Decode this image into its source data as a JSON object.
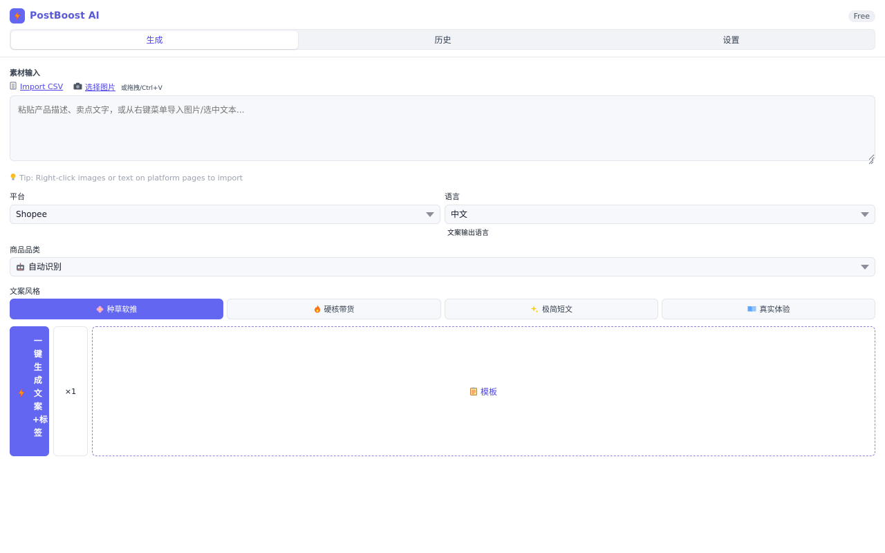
{
  "app": {
    "name": "PostBoost AI",
    "plan": "Free",
    "brand_color": "#6366f1"
  },
  "tabs": [
    {
      "label": "生成",
      "active": true
    },
    {
      "label": "历史",
      "active": false
    },
    {
      "label": "设置",
      "active": false
    }
  ],
  "material": {
    "label": "素材输入",
    "import_csv": "Import CSV",
    "choose_image": "选择图片",
    "drag_hint": "或拖拽/Ctrl+V",
    "placeholder": "粘贴产品描述、卖点文字，或从右键菜单导入图片/选中文本...",
    "tip": "Tip: Right-click images or text on platform pages to import"
  },
  "platform": {
    "label": "平台",
    "value": "Shopee"
  },
  "language": {
    "label": "语言",
    "value": "中文",
    "hint": "文案输出语言"
  },
  "category": {
    "label": "商品品类",
    "value": "自动识别"
  },
  "style": {
    "label": "文案风格",
    "options": [
      {
        "label": "种草软推",
        "icon": "flower-icon",
        "active": true
      },
      {
        "label": "硬核带货",
        "icon": "fire-icon",
        "active": false
      },
      {
        "label": "极简短文",
        "icon": "sparkles-icon",
        "active": false
      },
      {
        "label": "真实体验",
        "icon": "book-icon",
        "active": false
      }
    ]
  },
  "actions": {
    "generate_label": "一键生成文案+标签",
    "count": "×1",
    "template_label": "模板"
  }
}
